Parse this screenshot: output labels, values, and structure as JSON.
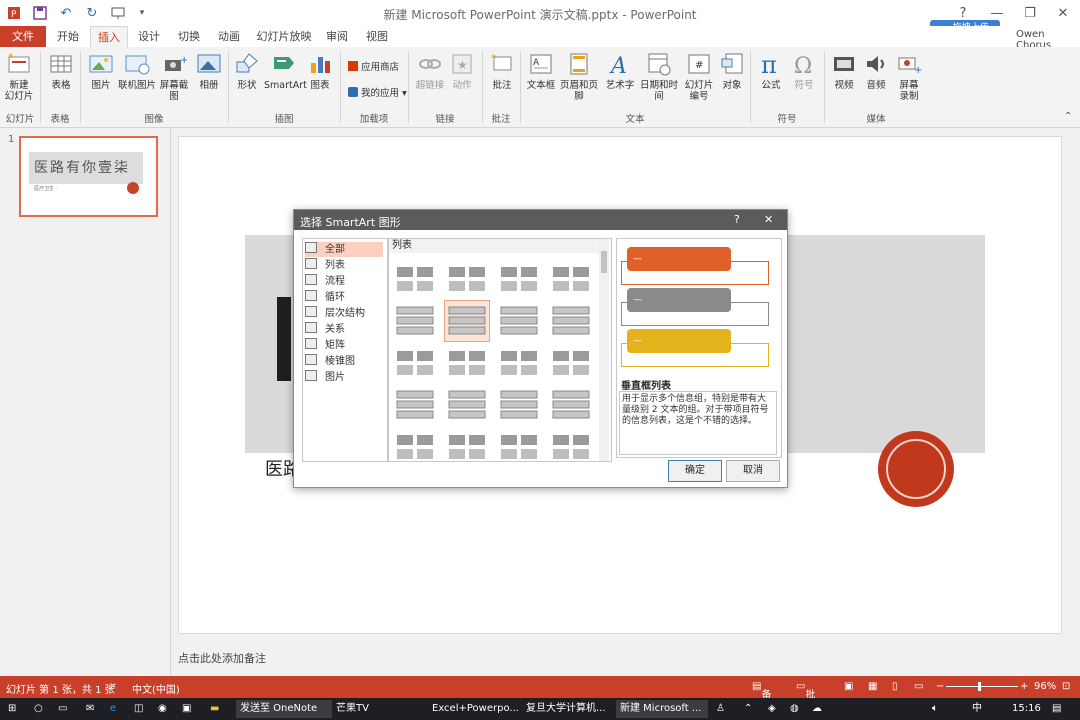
{
  "window": {
    "title": "新建 Microsoft PowerPoint 演示文稿.pptx - PowerPoint",
    "user": "Owen Chorus",
    "cloud_upload": "拖拽上传",
    "help": "?",
    "minimize": "—",
    "restore": "❐",
    "close": "✕"
  },
  "tabs": [
    "文件",
    "开始",
    "插入",
    "设计",
    "切换",
    "动画",
    "幻灯片放映",
    "审阅",
    "视图"
  ],
  "ribbon": {
    "buttons": [
      {
        "label": "新建\n幻灯片",
        "icon": "new-slide-icon"
      },
      {
        "label": "表格",
        "icon": "table-icon"
      },
      {
        "label": "图片",
        "icon": "picture-icon"
      },
      {
        "label": "联机图片",
        "icon": "online-picture-icon"
      },
      {
        "label": "屏幕截图",
        "icon": "screenshot-icon"
      },
      {
        "label": "相册",
        "icon": "album-icon"
      },
      {
        "label": "形状",
        "icon": "shapes-icon"
      },
      {
        "label": "SmartArt",
        "icon": "smartart-icon"
      },
      {
        "label": "图表",
        "icon": "chart-icon"
      },
      {
        "label": "超链接",
        "icon": "hyperlink-icon"
      },
      {
        "label": "动作",
        "icon": "action-icon"
      },
      {
        "label": "批注",
        "icon": "comment-icon"
      },
      {
        "label": "文本框",
        "icon": "textbox-icon"
      },
      {
        "label": "页眉和页脚",
        "icon": "header-footer-icon"
      },
      {
        "label": "艺术字",
        "icon": "wordart-icon"
      },
      {
        "label": "日期和时间",
        "icon": "datetime-icon"
      },
      {
        "label": "幻灯片\n编号",
        "icon": "slide-number-icon"
      },
      {
        "label": "对象",
        "icon": "object-icon"
      },
      {
        "label": "公式",
        "icon": "equation-icon"
      },
      {
        "label": "符号",
        "icon": "symbol-icon"
      },
      {
        "label": "视频",
        "icon": "video-icon"
      },
      {
        "label": "音频",
        "icon": "audio-icon"
      },
      {
        "label": "屏幕\n录制",
        "icon": "screen-record-icon"
      }
    ],
    "store": "应用商店",
    "my_apps": "我的应用 ▾",
    "groups": [
      "幻灯片",
      "表格",
      "图像",
      "插图",
      "加载项",
      "链接",
      "批注",
      "文本",
      "符号",
      "媒体"
    ]
  },
  "thumbnail": {
    "number": "1",
    "title": "医路有你壹柒",
    "subtitle": "医疗卫生 ·"
  },
  "slide": {
    "title_fragment": "医路"
  },
  "notes_placeholder": "点击此处添加备注",
  "dialog": {
    "title": "选择 SmartArt 图形",
    "help": "?",
    "close": "✕",
    "categories": [
      "全部",
      "列表",
      "流程",
      "循环",
      "层次结构",
      "关系",
      "矩阵",
      "棱锥图",
      "图片"
    ],
    "selected_category": "全部",
    "gallery_header": "列表",
    "preview_name": "垂直框列表",
    "preview_desc": "用于显示多个信息组，特别是带有大量级别 2 文本的组。对于带项目符号的信息列表，这是个不错的选择。",
    "preview_bullet": "—",
    "ok": "确定",
    "cancel": "取消",
    "preview_colors": [
      "#e0602a",
      "#8a8a8a",
      "#e3b21c"
    ]
  },
  "status": {
    "slide_info": "幻灯片 第 1 张，共 1 张",
    "language": "中文(中国)",
    "notes": "备注",
    "comments": "批注",
    "zoom": "96%"
  },
  "taskbar": {
    "items": [
      "发送至 OneNote",
      "芒果TV",
      "Excel+Powerpo...",
      "复旦大学计算机...",
      "新建 Microsoft ..."
    ],
    "ime": "中",
    "clock": "15:16"
  }
}
